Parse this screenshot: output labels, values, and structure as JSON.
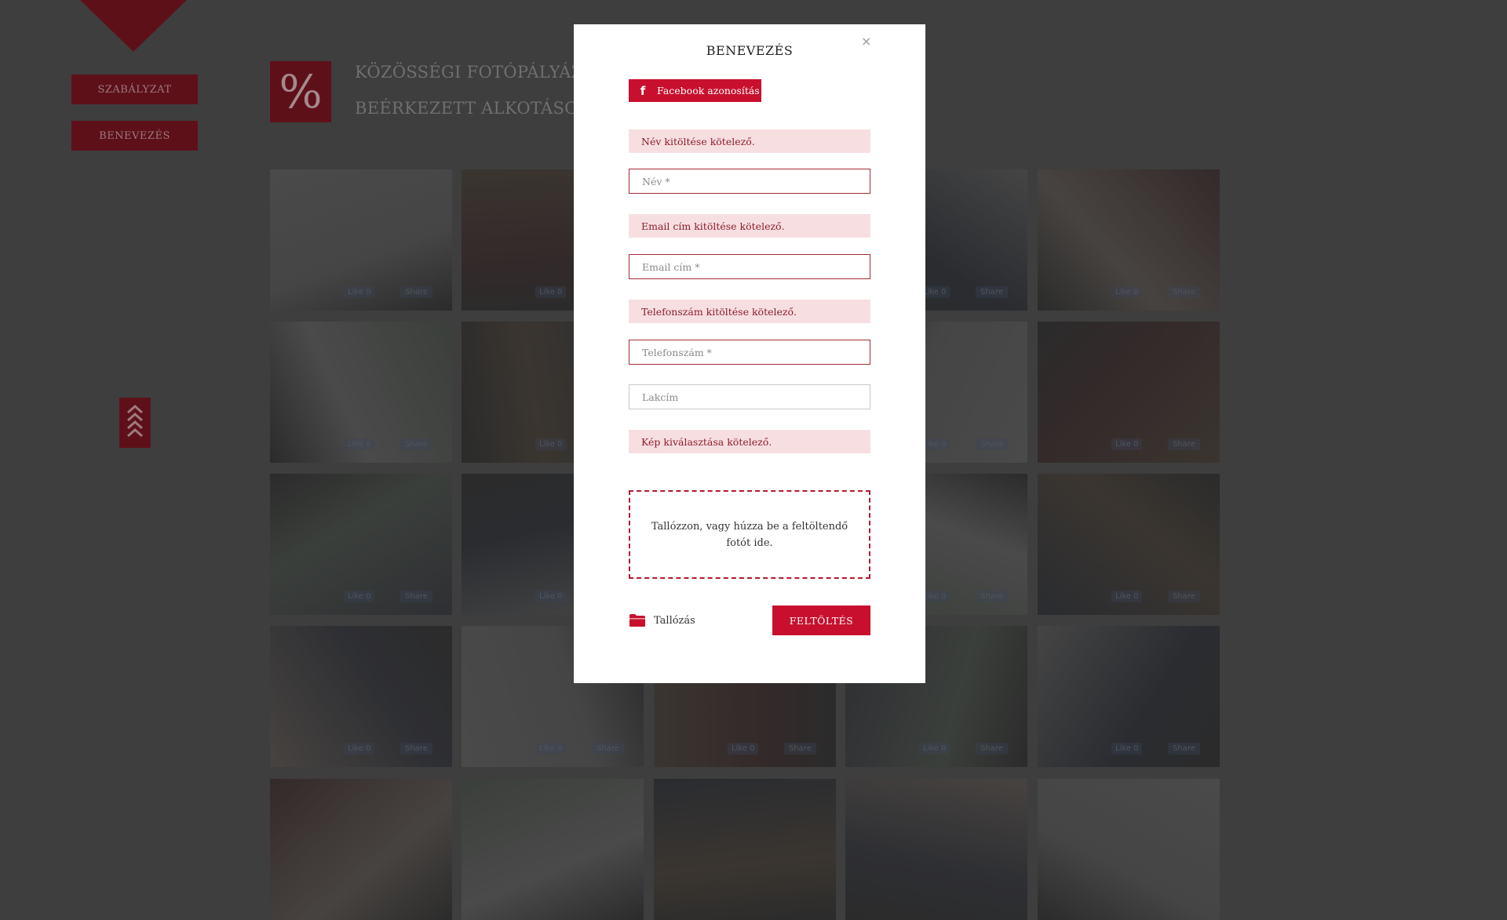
{
  "sidebar": {
    "rules_label": "SZABÁLYZAT",
    "entry_label": "BENEVEZÉS",
    "scroll_up_glyph": "⌃⌃⌃"
  },
  "header": {
    "logo_glyph": "%",
    "line1": "KÖZÖSSÉGI FOTÓPÁLYÁZ",
    "line2": "BEÉRKEZETT ALKOTÁSO"
  },
  "gallery": {
    "like_label": "Like 0",
    "share_label": "Share"
  },
  "modal": {
    "title": "BENEVEZÉS",
    "close_glyph": "×",
    "facebook_button": "Facebook azonosítás",
    "errors": {
      "name": "Név kitöltése kötelező.",
      "email": "Email cím kitöltése kötelező.",
      "phone": "Telefonszám kitöltése kötelező.",
      "image": "Kép kiválasztása kötelező."
    },
    "placeholders": {
      "name": "Név *",
      "email": "Email cím *",
      "phone": "Telefonszám *",
      "address": "Lakcím"
    },
    "dropzone_text": "Tallózzon, vagy húzza be a feltöltendő fotót ide.",
    "browse_label": "Tallózás",
    "upload_button": "FELTÖLTÉS"
  },
  "colors": {
    "accent": "#c8102e",
    "overlay_accent": "#5e1019",
    "error_bg": "#f7dfe1",
    "error_text": "#8e1d2b"
  }
}
